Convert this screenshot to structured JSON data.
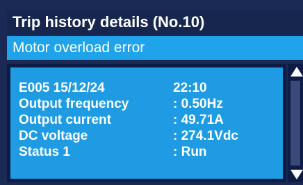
{
  "header": {
    "title": "Trip history details (No.10)",
    "subtitle": "Motor overload error"
  },
  "details": {
    "record": {
      "label": "E005 15/12/24",
      "value": "22:10"
    },
    "rows": [
      {
        "label": "Output frequency",
        "value": ": 0.50Hz"
      },
      {
        "label": "Output current",
        "value": ": 49.71A"
      },
      {
        "label": "DC voltage",
        "value": ": 274.1Vdc"
      },
      {
        "label": "Status 1",
        "value": ": Run"
      }
    ]
  },
  "colors": {
    "title_bg": "#17264f",
    "subtitle_bg": "#1fa3ea",
    "panel_bg": "#1e9be3",
    "frame": "#0d1c45",
    "text": "#ffffff"
  },
  "icons": {
    "scroll_up": "triangle-up-icon",
    "scroll_down": "triangle-down-icon"
  }
}
